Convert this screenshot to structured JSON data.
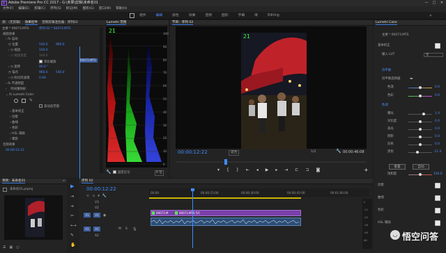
{
  "app": {
    "title": "Adobe Premiere Pro CC 2017 - G:\\未果\\剪辑\\未命名01",
    "logo_text": "Pr",
    "window_controls": [
      "—",
      "□",
      "✕"
    ]
  },
  "menu": [
    "文件(F)",
    "编辑(E)",
    "剪辑(C)",
    "序列(S)",
    "标记(M)",
    "图形(G)",
    "窗口(W)",
    "帮助(H)"
  ],
  "workspaces": {
    "tabs": [
      "组件",
      "编辑",
      "颜色",
      "效果",
      "音频",
      "图形",
      "字幕",
      "库",
      "Editing"
    ],
    "active_index": 1,
    "more": "»"
  },
  "effect_controls": {
    "tabs": [
      "源：(无剪辑)",
      "效果控件",
      "音频剪辑混合器：序列02",
      "元数据"
    ],
    "active_index": 1,
    "source_label": "主要 * 00073.MTS",
    "seq_label": "序列 02 * 00073.MTS",
    "clip_label": "00073.MTS",
    "video_effects": "视频效果",
    "motion": "运动",
    "position": {
      "label": "位置",
      "x": "540.0",
      "y": "960.0"
    },
    "scale": {
      "label": "缩放",
      "value": "100.0"
    },
    "scale_width": {
      "label": "缩放宽度",
      "value": "100.0"
    },
    "uniform_scale": "等比缩放",
    "rotation": {
      "label": "旋转",
      "value": "90.0 °"
    },
    "anchor": {
      "label": "锚点",
      "x": "960.0",
      "y": "540.0"
    },
    "anti_flicker": {
      "label": "防闪烁滤镜",
      "value": "0.00"
    },
    "opacity": "不透明度",
    "time_remap": "时间重映射",
    "lumetri": "Lumetri Color",
    "hdr_range": "高动态范围",
    "sections": [
      "基本校正",
      "创意",
      "曲线",
      "色轮",
      "HSL 辅助",
      "晕影"
    ],
    "audio_effects": "音频效果",
    "timecode": "00:00:12:22"
  },
  "scopes": {
    "title": "Lumetri 范围",
    "ticks": [
      "100",
      "90",
      "80",
      "70",
      "60",
      "50",
      "40",
      "30",
      "20",
      "10",
      "0"
    ],
    "clamp_label": "固定信号",
    "bit_label": "8 位"
  },
  "program": {
    "title": "节目：序列 02",
    "timecode": "00:00:12:22",
    "fit": "适合",
    "quality": "1/2",
    "duration": "00:00:46:08",
    "overlay": "21"
  },
  "lumetri_panel": {
    "title": "Lumetri Color",
    "clip": "主要 * 00073.MTS",
    "basic": "基本校正",
    "input_lut_label": "输入 LUT",
    "input_lut_value": "无",
    "white_balance": "白平衡",
    "wb_selector": "白平衡选择器",
    "temperature": {
      "label": "色温",
      "value": "0.0"
    },
    "tint": {
      "label": "色彩",
      "value": "0.0"
    },
    "tone": "色调",
    "exposure": {
      "label": "曝光",
      "value": "1.0"
    },
    "contrast": {
      "label": "对比度",
      "value": "0.0"
    },
    "highlights": {
      "label": "高光",
      "value": "0.0"
    },
    "shadows": {
      "label": "阴影",
      "value": "0.0"
    },
    "whites": {
      "label": "白色",
      "value": "0.0"
    },
    "blacks": {
      "label": "黑色",
      "value": "-11.0"
    },
    "reset": "重置",
    "auto": "自动",
    "saturation": {
      "label": "饱和度",
      "value": "100.0"
    },
    "collapsed": [
      "创意",
      "曲线",
      "色轮",
      "HSL 辅助"
    ]
  },
  "project": {
    "title": "项目：未命名01",
    "file": "未命名01.prproj",
    "more": "»"
  },
  "timeline": {
    "title": "序列 02",
    "timecode": "00:00:12:22",
    "ruler": [
      "00:00",
      "00:00:15:00",
      "00:00:30:00",
      "00:00:45:00",
      "00:01:00:00"
    ],
    "tracks": [
      "V3",
      "V2",
      "V1",
      "A1",
      "A2"
    ],
    "clip_v1a": "00073.M",
    "clip_v1b": "00073.MTS [V]",
    "db_ticks": [
      "0",
      "-12",
      "-24",
      "-36",
      "-48",
      "dB"
    ]
  },
  "watermark": "悟空问答",
  "colors": {
    "accent": "#3f8dff",
    "panel": "#232323"
  }
}
